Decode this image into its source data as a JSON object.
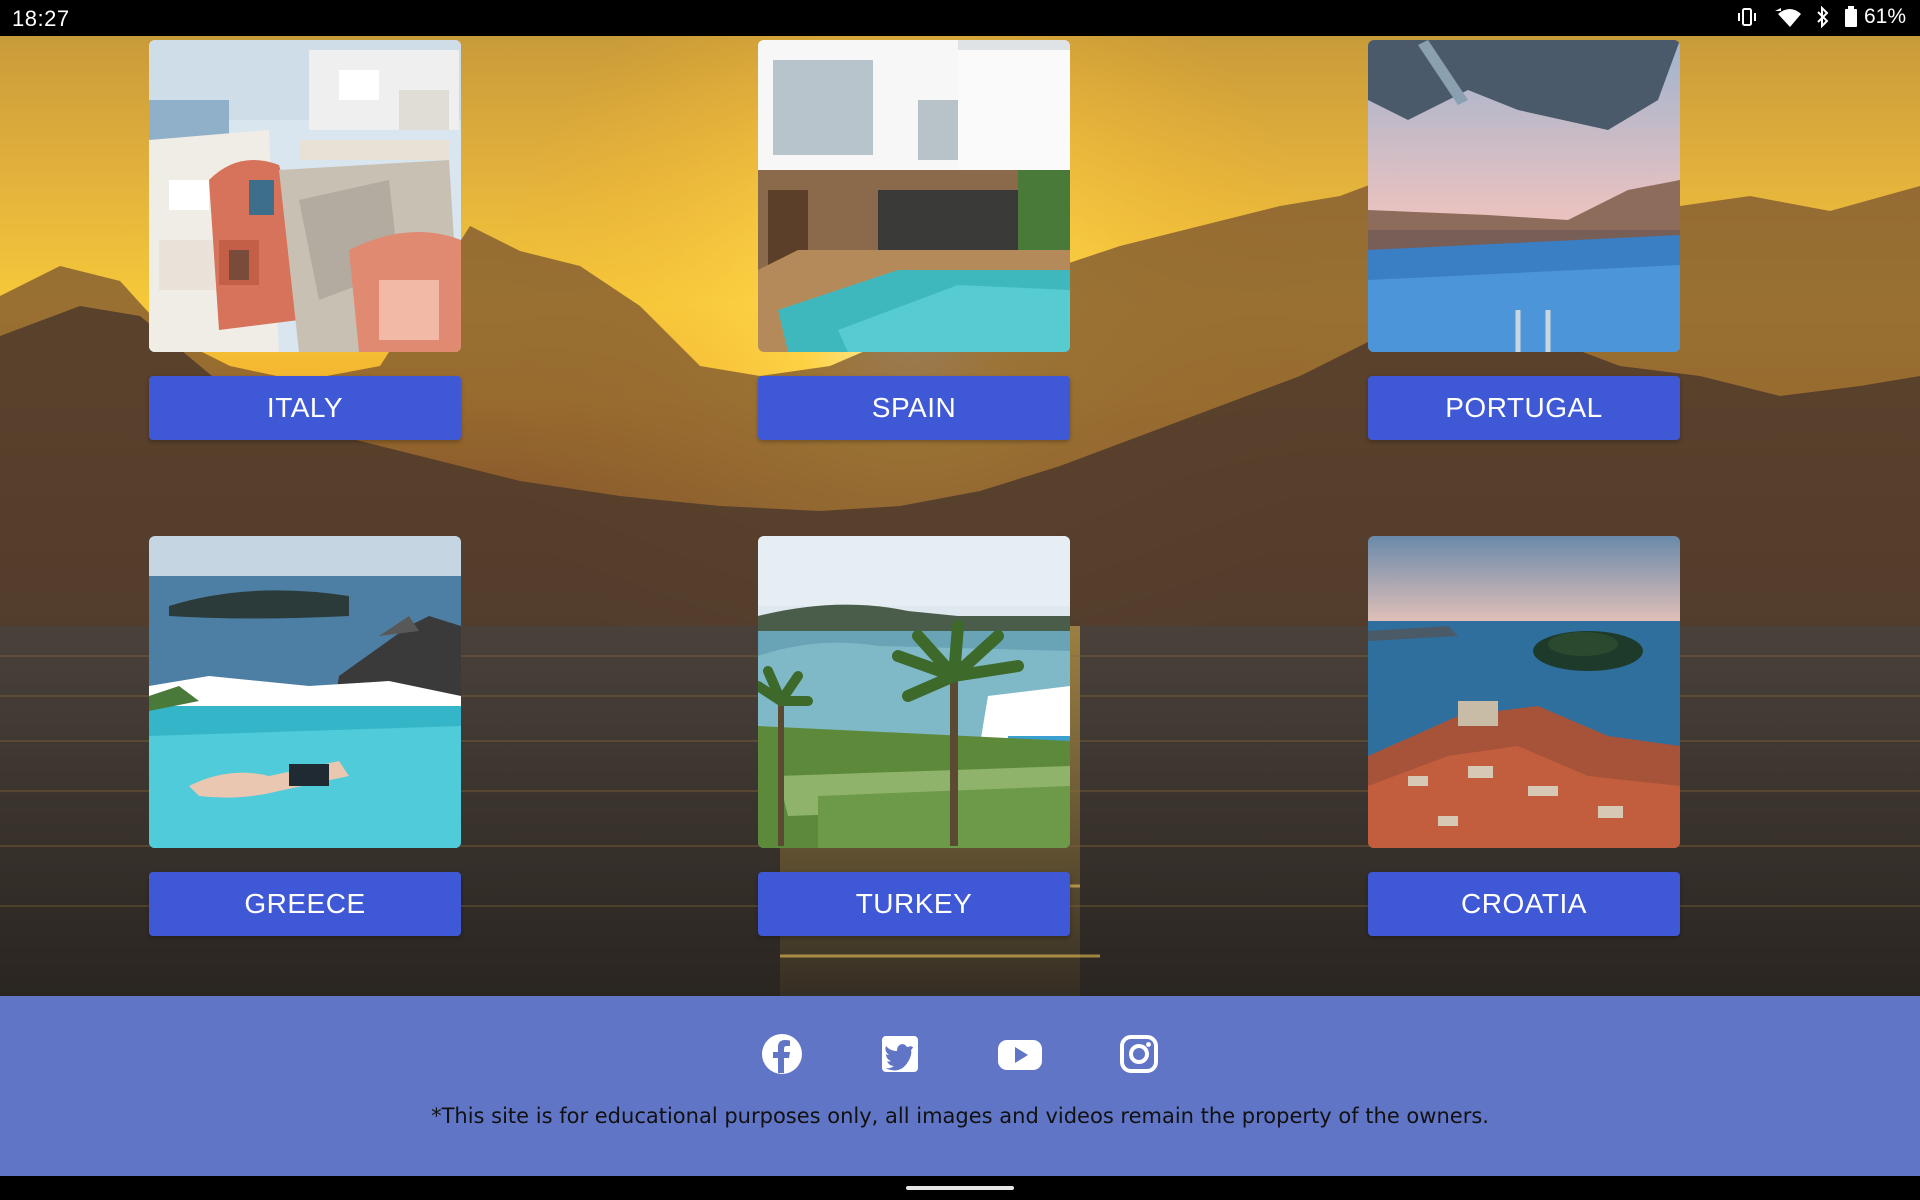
{
  "status_bar": {
    "time": "18:27",
    "battery": "61%"
  },
  "destinations": [
    {
      "label": "ITALY",
      "image": "santorini-style white village with terracotta houses"
    },
    {
      "label": "SPAIN",
      "image": "modern white villa with pool"
    },
    {
      "label": "PORTUGAL",
      "image": "infinity pool overlooking sunset city"
    },
    {
      "label": "GREECE",
      "image": "swimmer in infinity pool by the sea"
    },
    {
      "label": "TURKEY",
      "image": "resort with palm trees and bay"
    },
    {
      "label": "CROATIA",
      "image": "aerial view of old town with red roofs and island"
    }
  ],
  "footer": {
    "social": [
      "facebook-icon",
      "twitter-icon",
      "youtube-icon",
      "instagram-icon"
    ],
    "disclaimer": "*This site is for educational purposes only, all images and videos remain the property of the owners."
  },
  "colors": {
    "button": "#3f58d6",
    "footer": "#6075c6"
  }
}
